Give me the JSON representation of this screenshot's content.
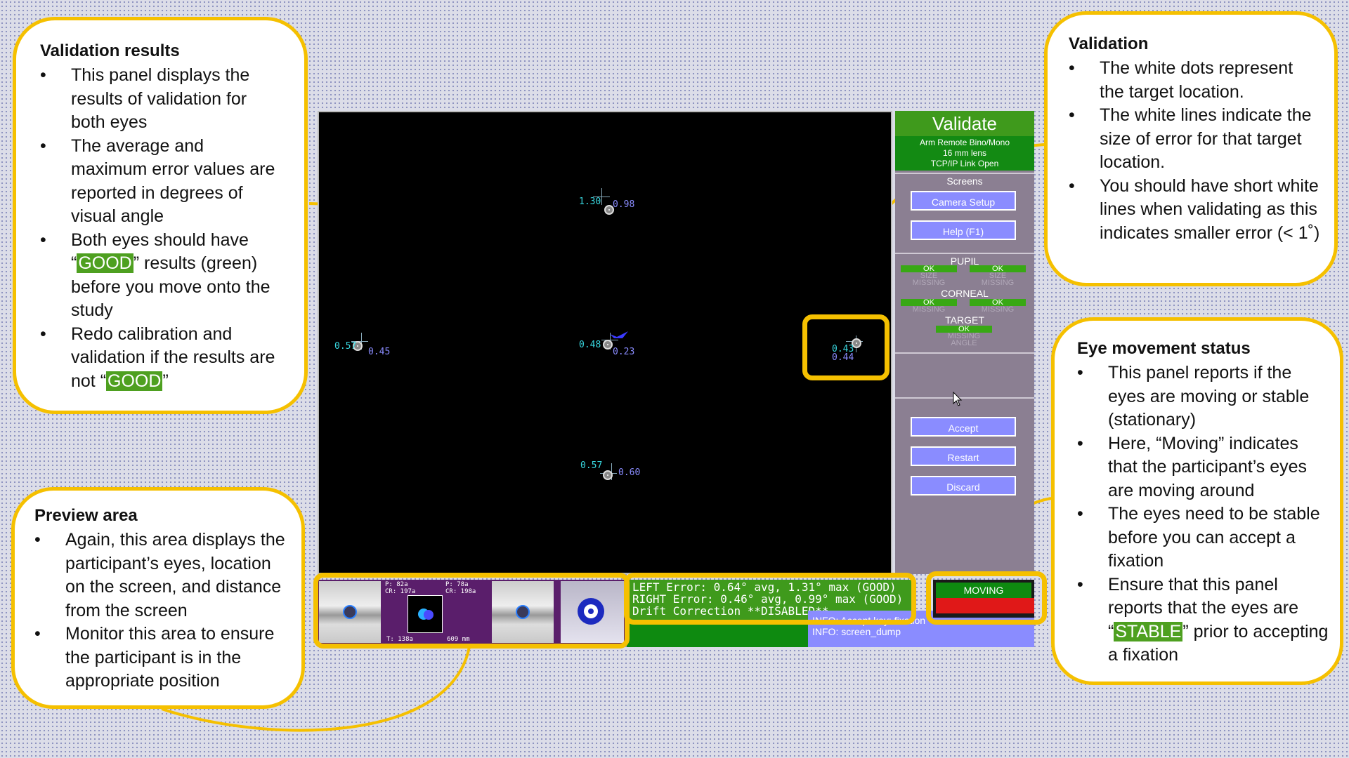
{
  "callouts": {
    "validation_results": {
      "title": "Validation results",
      "items": [
        "This panel displays the results of validation for both eyes",
        "The average and maximum error values are reported in degrees of visual angle",
        [
          "Both eyes should have “",
          "GOOD",
          "” results (green) before you move onto the study"
        ],
        [
          "Redo calibration and validation if the results are not “",
          "GOOD",
          "”"
        ]
      ]
    },
    "validation": {
      "title": "Validation",
      "items": [
        "The white dots represent the target location.",
        "The white lines indicate the size of error for that target location.",
        "You should have short white lines when validating as this indicates smaller error (< 1˚)"
      ]
    },
    "preview_area": {
      "title": "Preview area",
      "items": [
        "Again, this area displays the participant’s eyes, location on the screen, and distance from the screen",
        "Monitor this area to ensure the participant is in the appropriate position"
      ]
    },
    "eye_movement": {
      "title": "Eye movement status",
      "items": [
        "This panel reports if the eyes are moving or stable (stationary)",
        "Here, “Moving” indicates that the participant’s eyes are moving around",
        "The eyes need to be stable before you can accept a fixation",
        [
          "Ensure that this panel reports that the eyes are “",
          "STABLE",
          "” prior to accepting a fixation"
        ]
      ]
    }
  },
  "screen": {
    "targets": [
      {
        "left": "1.30",
        "right": "0.98"
      },
      {
        "left": "0.57",
        "right": "0.45"
      },
      {
        "left": "0.48",
        "right": "0.23"
      },
      {
        "left": "0.43",
        "right": "0.44"
      },
      {
        "left": "0.57",
        "right": "0.60"
      }
    ]
  },
  "panel": {
    "title": "Validate",
    "sub1": "Arm Remote Bino/Mono",
    "sub2": "16 mm lens",
    "sub3": "TCP/IP Link Open",
    "screens_label": "Screens",
    "camera_setup": "Camera Setup",
    "help": "Help (F1)",
    "pupil": "PUPIL",
    "corneal": "CORNEAL",
    "target": "TARGET",
    "ok": "OK",
    "size": "SIZE",
    "missing": "MISSING",
    "angle": "ANGLE",
    "accept": "Accept",
    "restart": "Restart",
    "discard": "Discard"
  },
  "preview": {
    "p1": "P:  82a",
    "cr1": "CR: 197a",
    "p2": "P:  78a",
    "cr2": "CR: 198a",
    "t": "T: 138a",
    "dist": "609 mm"
  },
  "results": {
    "left": "LEFT  Error:  0.64° avg,  1.31° max (GOOD)",
    "right": "RIGHT Error:  0.46° avg,  0.99° max (GOOD)",
    "drift": "Drift Correction **DISABLED**"
  },
  "info": {
    "line1": "INFO: Accept key: fixation",
    "line2": "INFO: screen_dump"
  },
  "status": {
    "label": "MOVING"
  },
  "colors": {
    "callout_border": "#f5c000",
    "good_green": "#4ea020",
    "moving_red": "#e01818"
  }
}
